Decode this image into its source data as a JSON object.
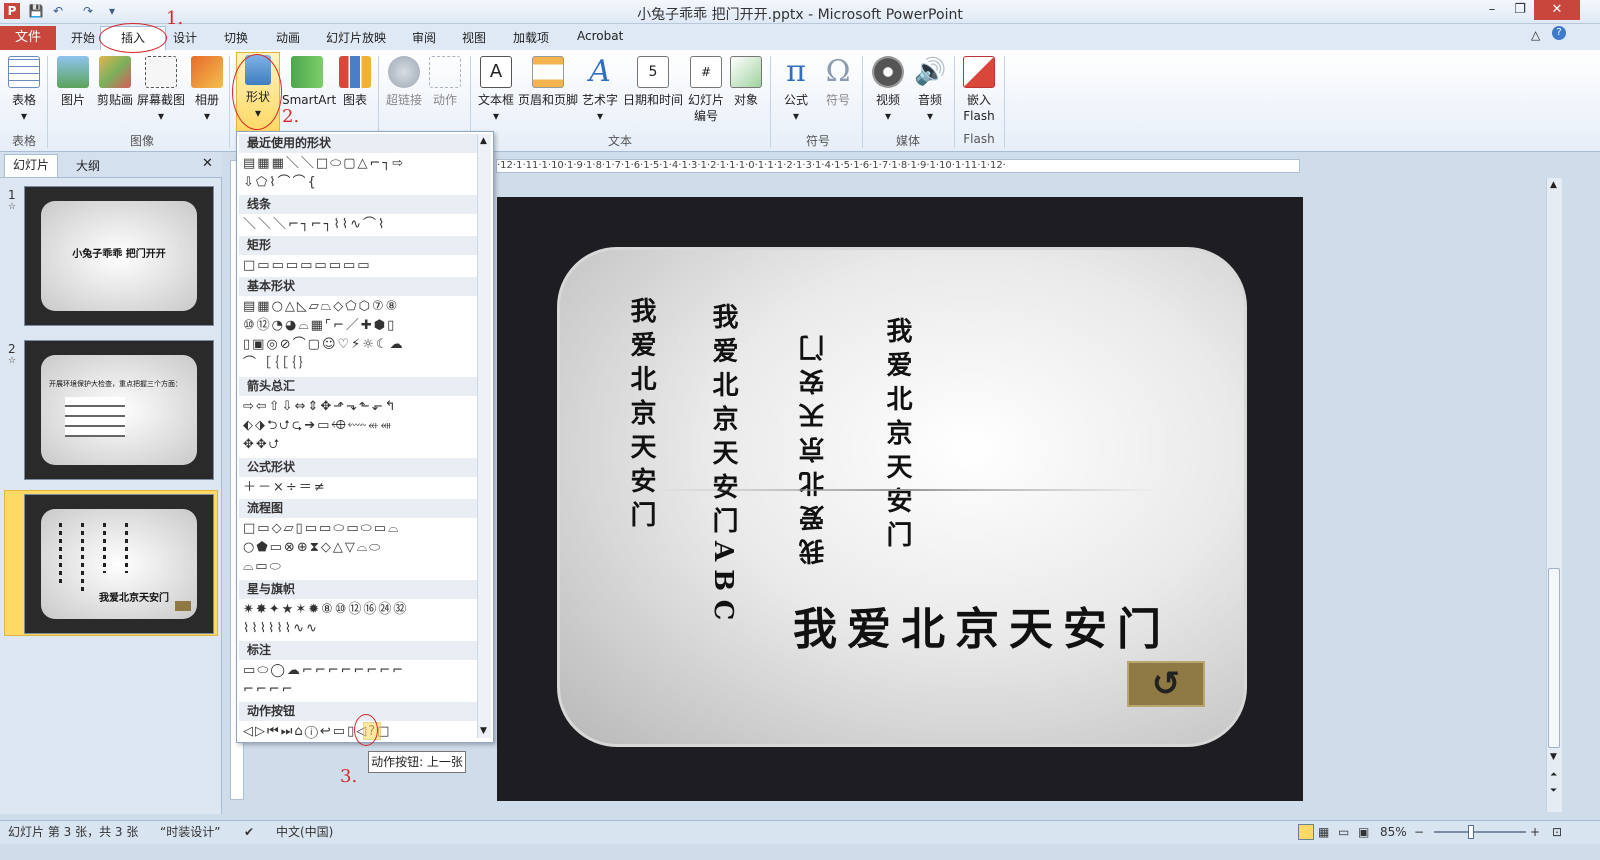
{
  "window": {
    "title": "小兔子乖乖 把门开开.pptx - Microsoft PowerPoint",
    "controls": {
      "minimize": "–",
      "restore": "❐",
      "close": "✕"
    }
  },
  "tabs": {
    "file": "文件",
    "items": [
      "开始",
      "插入",
      "设计",
      "切换",
      "动画",
      "幻灯片放映",
      "审阅",
      "视图",
      "加载项",
      "Acrobat"
    ]
  },
  "ribbon": {
    "buttons": {
      "table": "表格",
      "picture": "图片",
      "clipart": "剪贴画",
      "screenshot": "屏幕截图",
      "album": "相册",
      "shapes": "形状",
      "smartart": "SmartArt",
      "chart": "图表",
      "hyperlink": "超链接",
      "action": "动作",
      "textbox": "文本框",
      "header_footer": "页眉和页脚",
      "wordart": "艺术字",
      "datetime": "日期和时间",
      "slide_number_1": "幻灯片",
      "slide_number_2": "编号",
      "object": "对象",
      "equation": "公式",
      "symbol": "符号",
      "video": "视频",
      "audio": "音频",
      "embed_flash_1": "嵌入",
      "embed_flash_2": "Flash"
    },
    "groups": {
      "tables": "表格",
      "images": "图像",
      "text": "文本",
      "symbols": "符号",
      "media": "媒体",
      "flash": "Flash"
    }
  },
  "panel": {
    "tab_slides": "幻灯片",
    "tab_outline": "大纲",
    "close": "✕",
    "slides": [
      {
        "num": "1",
        "text": "小兔子乖乖 把门开开"
      },
      {
        "num": "2",
        "text": "开展环境保护大检查，重点把握三个方面："
      },
      {
        "num": "3",
        "text": "我爱北京天安门"
      }
    ]
  },
  "shapes_menu": {
    "categories": [
      {
        "label": "最近使用的形状",
        "rows": [
          "▤▦▦＼＼□⬭▢△⌐┐⇨",
          "⇩⬠⌇⌒⌒{"
        ]
      },
      {
        "label": "线条",
        "rows": [
          "＼＼＼⌐┐⌐┐⌇⌇∿⌒⌇"
        ]
      },
      {
        "label": "矩形",
        "rows": [
          "□▭▭▭▭▭▭▭▭"
        ]
      },
      {
        "label": "基本形状",
        "rows": [
          "▤▦○△◺▱⏢◇⬠⬡⑦⑧",
          "⑩⑫◔◕⌓▦⌜⌐／✚⬢▯",
          "▯▣◎⊘⌒▢☺♡⚡☼☾☁",
          "⌒［｛［｛｝"
        ]
      },
      {
        "label": "箭头总汇",
        "rows": [
          "⇨⇦⇧⇩⇔⇕✥⬏⬎⬑⬐↰",
          "⬖⬗⮌⮍⮎➔▭⬲⬳⬴⬵",
          "✥✥⮍"
        ]
      },
      {
        "label": "公式形状",
        "rows": [
          "＋－×÷＝≠"
        ]
      },
      {
        "label": "流程图",
        "rows": [
          "□▭◇▱▯▭▭⬭▭⬭▭⌓",
          "○⬟▭⊗⊕⧗◇△▽⌓⬭",
          "⌓▭⬭"
        ]
      },
      {
        "label": "星与旗帜",
        "rows": [
          "✷✸✦★✶✹⑧⑩⑫⑯㉔㉜",
          "⌇⌇⌇⌇⌇⌇∿∿"
        ]
      },
      {
        "label": "标注",
        "rows": [
          "▭⬭◯☁⌐⌐⌐⌐⌐⌐⌐⌐",
          "⌐⌐⌐⌐"
        ]
      },
      {
        "label": "动作按钮",
        "rows": [
          "◁▷⏮⏭⌂ⓘ↩▭▯◁?□"
        ]
      }
    ],
    "tooltip": "动作按钮: 上一张"
  },
  "ruler": {
    "horizontal": "·12·1·11·1·10·1·9·1·8·1·7·1·6·1·5·1·4·1·3·1·2·1·1·1·0·1·1·1·2·1·3·1·4·1·5·1·6·1·7·1·8·1·9·1·10·1·11·1·12·"
  },
  "slide": {
    "col1": "我爱北京天安门",
    "col2": "我爱北京天安门ABC",
    "col3": "我爱北京天安门",
    "col4": "我爱北京天安门",
    "horizontal": "我爱北京天安门",
    "back_button": "↺"
  },
  "annotations": {
    "step1": "1.",
    "step2": "2.",
    "step3": "3."
  },
  "status": {
    "slide_info": "幻灯片 第 3 张，共 3 张",
    "theme": "“时装设计”",
    "language": "中文(中国)",
    "zoom": "85%",
    "zoom_minus": "−",
    "zoom_plus": "+"
  },
  "colors": {
    "accent": "#c9463d",
    "ribbon_bg": "#e6eef8",
    "highlight": "#ffd966",
    "annotation": "#d42a2a"
  }
}
